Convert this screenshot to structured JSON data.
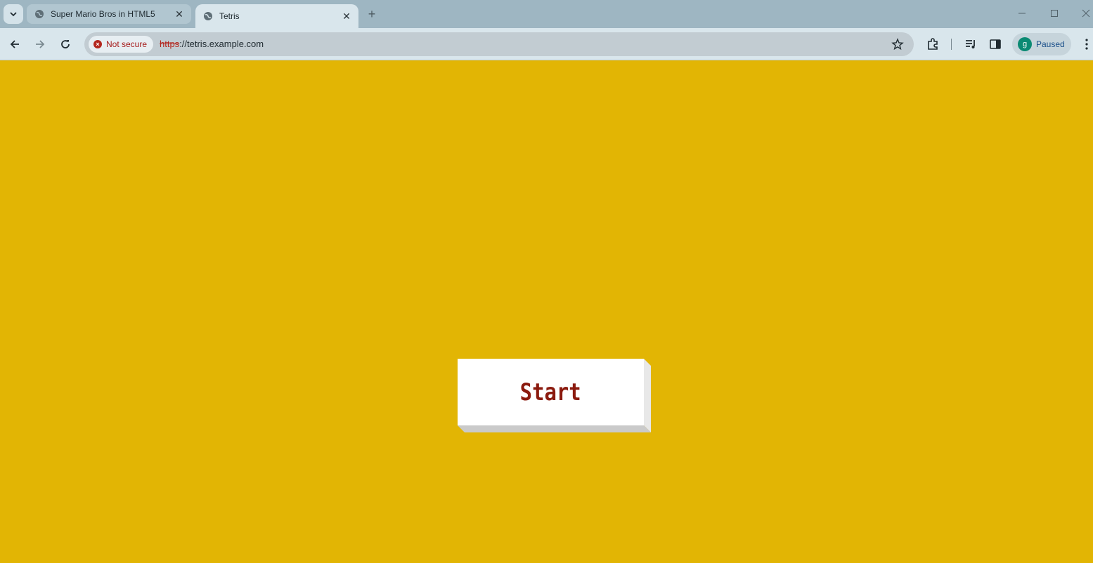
{
  "browser": {
    "tabs": [
      {
        "title": "Super Mario Bros in HTML5",
        "active": false
      },
      {
        "title": "Tetris",
        "active": true
      }
    ],
    "new_tab_symbol": "+",
    "security_label": "Not secure",
    "url_scheme": "https",
    "url_rest": "://tetris.example.com",
    "profile_initial": "g",
    "profile_status": "Paused"
  },
  "page": {
    "background_color": "#e2b504",
    "start_button_label": "Start",
    "start_text_color": "#8b1a0e"
  }
}
